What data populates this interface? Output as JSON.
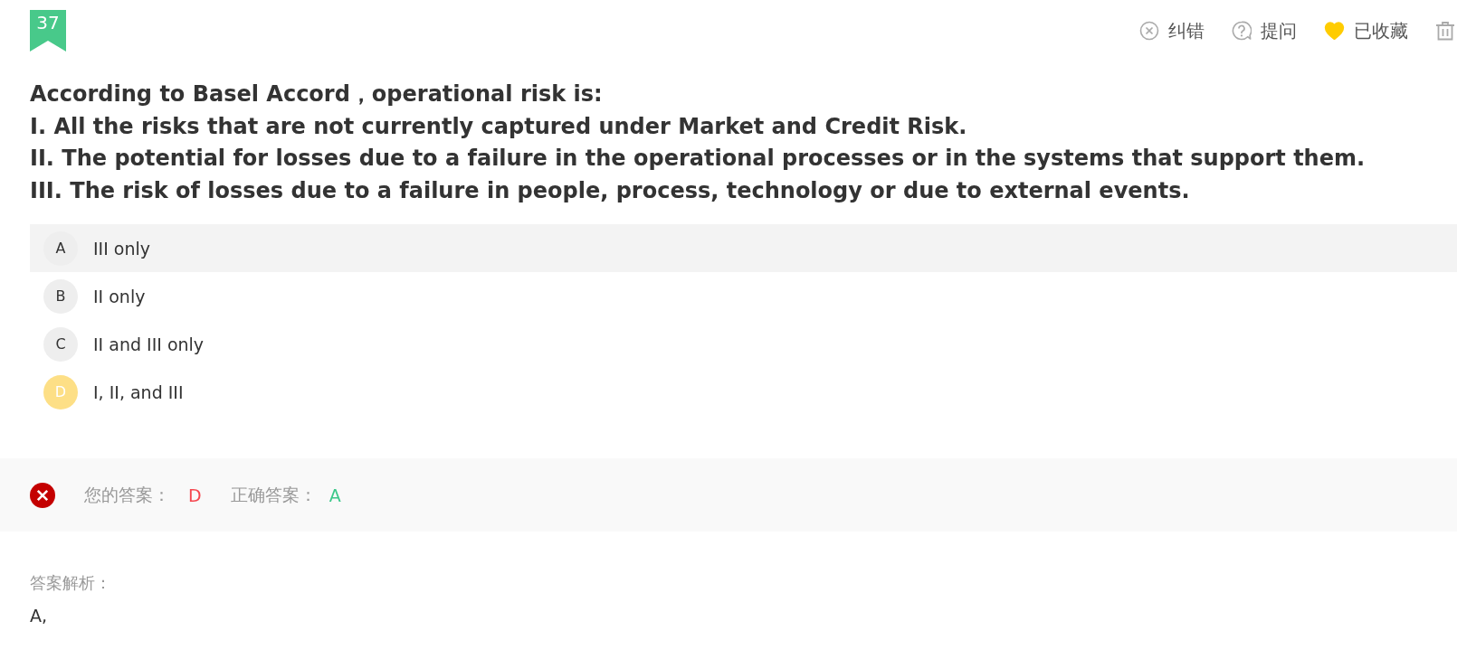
{
  "badge": {
    "number": "37"
  },
  "toolbar": [
    {
      "kind": "report",
      "label": "纠错"
    },
    {
      "kind": "ask",
      "label": "提问"
    },
    {
      "kind": "favorite",
      "label": "已收藏",
      "on": true
    },
    {
      "kind": "delete"
    }
  ],
  "question": {
    "stem": "According to Basel Accord，operational risk is:",
    "statements": [
      "I. All the risks that are not currently captured under Market and Credit Risk.",
      "II. The potential for losses due to a failure in the operational processes or in the systems that support them.",
      "III. The risk of losses due to a failure in people, process, technology or due to external events."
    ]
  },
  "options": [
    {
      "letter": "A",
      "text": "III only",
      "selected": false,
      "highlighted": true
    },
    {
      "letter": "B",
      "text": "II only",
      "selected": false,
      "highlighted": false
    },
    {
      "letter": "C",
      "text": "II and III only",
      "selected": false,
      "highlighted": false
    },
    {
      "letter": "D",
      "text": "I, II, and III",
      "selected": true,
      "highlighted": false
    }
  ],
  "result": {
    "correct": false,
    "your_answer_label": "您的答案：",
    "your_answer": "D",
    "correct_answer_label": "正确答案：",
    "correct_answer": "A"
  },
  "analysis": {
    "label": "答案解析：",
    "text": "A,"
  }
}
